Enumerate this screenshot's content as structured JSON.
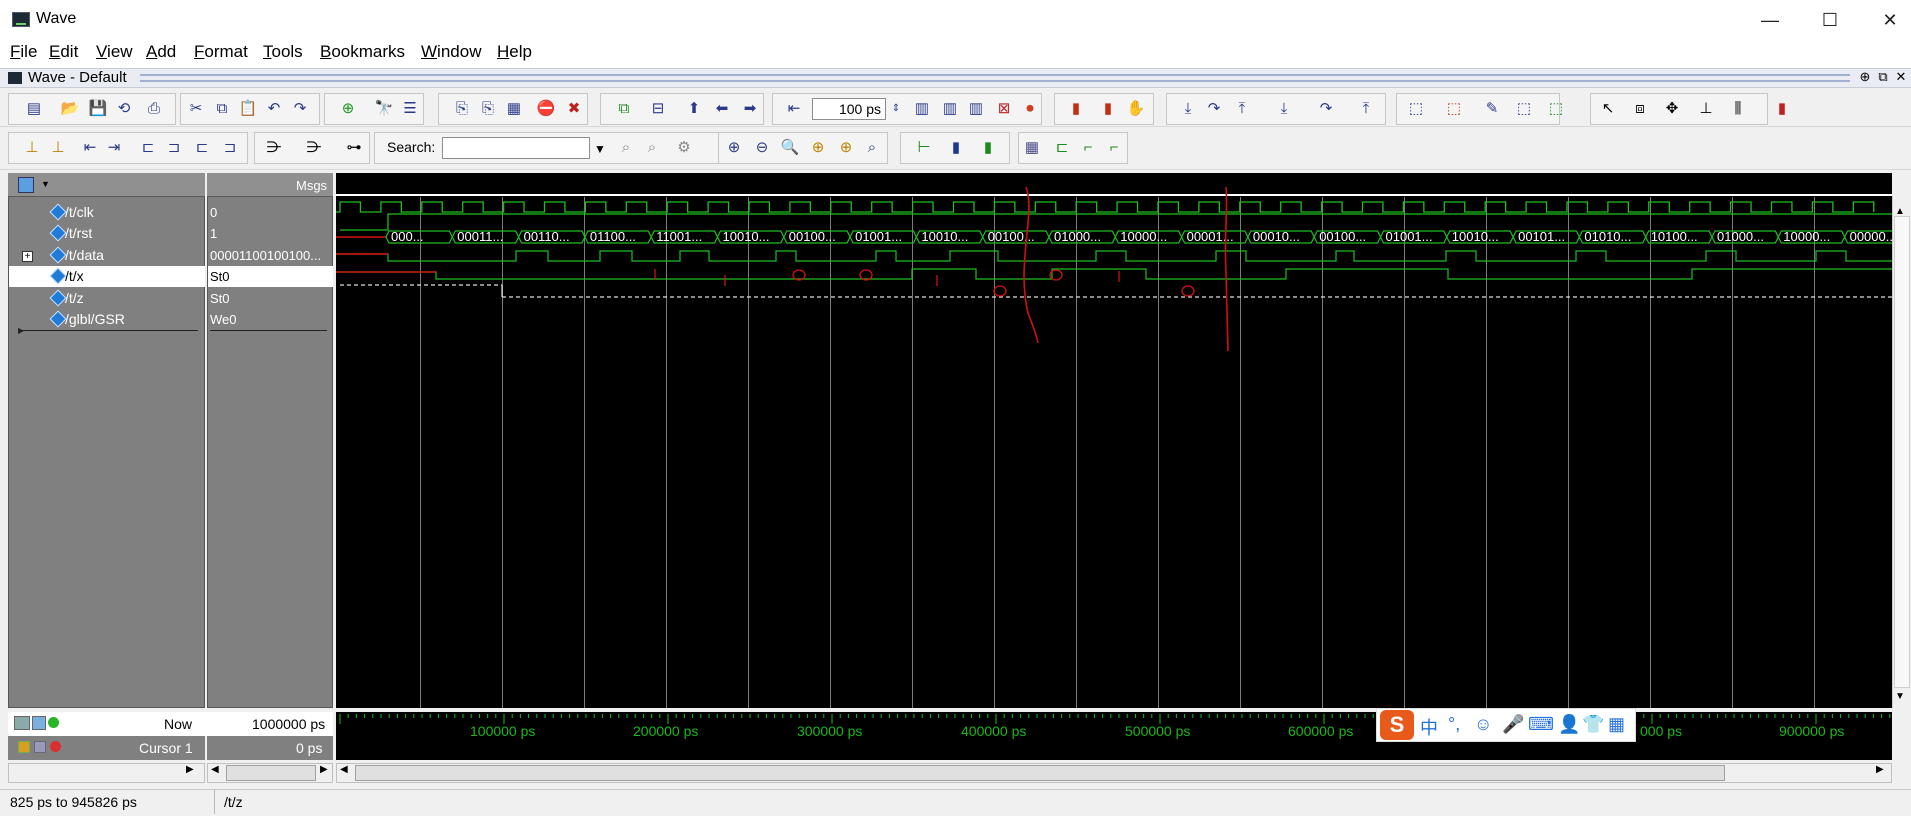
{
  "window": {
    "title": "Wave",
    "controls": {
      "minimize": "—",
      "maximize": "☐",
      "close": "✕"
    }
  },
  "menu": [
    "File",
    "Edit",
    "View",
    "Add",
    "Format",
    "Tools",
    "Bookmarks",
    "Window",
    "Help"
  ],
  "wave_header": {
    "title": "Wave - Default"
  },
  "toolbar": {
    "zoom_value": "100 ps",
    "search_label": "Search:",
    "search_value": ""
  },
  "signals_header": {
    "msgs_label": "Msgs"
  },
  "signals": [
    {
      "name": "/t/clk",
      "value": "0"
    },
    {
      "name": "/t/rst",
      "value": "1"
    },
    {
      "name": "/t/data",
      "value": "00001100100100..."
    },
    {
      "name": "/t/x",
      "value": "St0"
    },
    {
      "name": "/t/z",
      "value": "St0"
    },
    {
      "name": "/glbl/GSR",
      "value": "We0"
    }
  ],
  "data_bus_labels": [
    "000...",
    "00011...",
    "00110...",
    "01100...",
    "11001...",
    "10010...",
    "00100...",
    "01001...",
    "10010...",
    "00100...",
    "01000...",
    "10000...",
    "00001...",
    "00010...",
    "00100...",
    "01001...",
    "10010...",
    "00101...",
    "01010...",
    "10100...",
    "01000...",
    "10000...",
    "00000..."
  ],
  "cursor_area": {
    "now_label": "Now",
    "now_value": "1000000 ps",
    "cursor_label": "Cursor 1",
    "cursor_value": "0 ps"
  },
  "timeline_ticks": [
    "100000 ps",
    "200000 ps",
    "300000 ps",
    "400000 ps",
    "500000 ps",
    "600000 ps",
    "000 ps",
    "900000 ps"
  ],
  "status": {
    "range": "825 ps to 945826 ps",
    "selected_signal": "/t/z"
  },
  "ime": {
    "chinese_label": "中",
    "punct": "°,"
  },
  "colors": {
    "wave": "#1fbf1f",
    "pane_bg": "#808080",
    "wave_bg": "#000000",
    "annotation": "#d01010",
    "diamond": "#1e7bd7"
  }
}
